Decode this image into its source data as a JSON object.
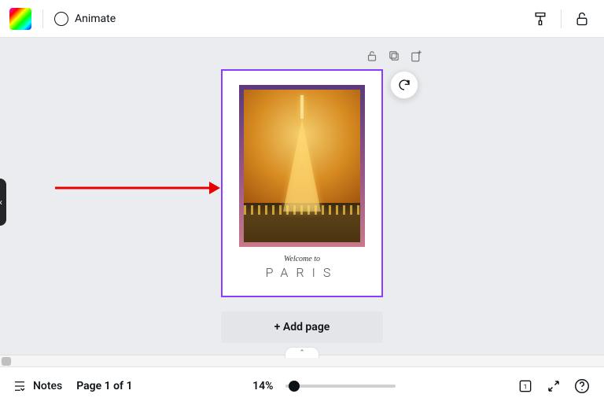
{
  "toolbar": {
    "animate_label": "Animate"
  },
  "page_controls": {
    "lock_icon": "lock-icon",
    "duplicate_icon": "duplicate-icon",
    "add_icon": "add-page-icon"
  },
  "canvas": {
    "caption_welcome": "Welcome to",
    "caption_city": "PARIS",
    "selection_color": "#8b3dff"
  },
  "add_page_label": "+ Add page",
  "footer": {
    "notes_label": "Notes",
    "page_indicator": "Page 1 of 1",
    "zoom_label": "14%",
    "zoom_value": 14
  }
}
